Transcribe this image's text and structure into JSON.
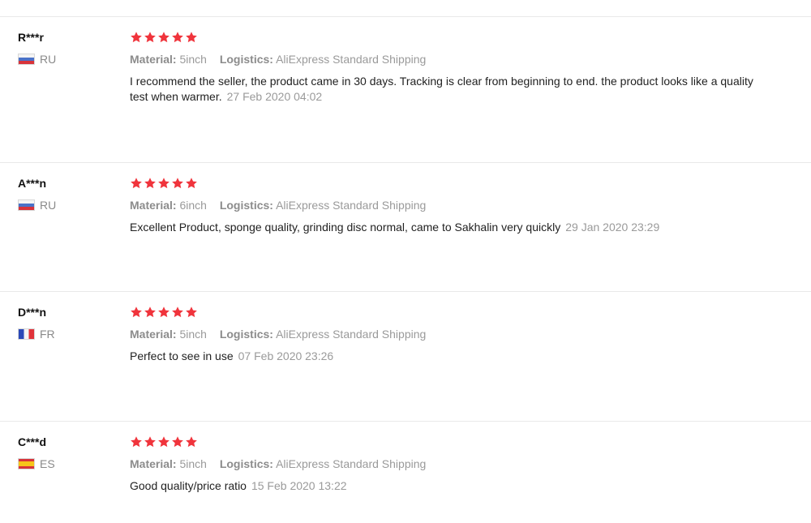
{
  "reviews": [
    {
      "user": "R***r",
      "country": "RU",
      "flag": "flag-ru",
      "rating": 5,
      "material_label": "Material:",
      "material_value": "5inch",
      "logistics_label": "Logistics:",
      "logistics_value": "AliExpress Standard Shipping",
      "text": "I recommend the seller, the product came in 30 days. Tracking is clear from beginning to end. the product looks like a quality test when warmer.",
      "date": "27 Feb 2020 04:02"
    },
    {
      "user": "A***n",
      "country": "RU",
      "flag": "flag-ru",
      "rating": 5,
      "material_label": "Material:",
      "material_value": "6inch",
      "logistics_label": "Logistics:",
      "logistics_value": "AliExpress Standard Shipping",
      "text": "Excellent Product, sponge quality, grinding disc normal, came to Sakhalin very quickly",
      "date": "29 Jan 2020 23:29"
    },
    {
      "user": "D***n",
      "country": "FR",
      "flag": "flag-fr",
      "rating": 5,
      "material_label": "Material:",
      "material_value": "5inch",
      "logistics_label": "Logistics:",
      "logistics_value": "AliExpress Standard Shipping",
      "text": "Perfect to see in use",
      "date": "07 Feb 2020 23:26"
    },
    {
      "user": "C***d",
      "country": "ES",
      "flag": "flag-es",
      "rating": 5,
      "material_label": "Material:",
      "material_value": "5inch",
      "logistics_label": "Logistics:",
      "logistics_value": "AliExpress Standard Shipping",
      "text": "Good quality/price ratio",
      "date": "15 Feb 2020 13:22"
    }
  ],
  "colors": {
    "star": "#f0343c",
    "muted": "#9a9a9a",
    "divider": "#e9e9e9"
  },
  "icons": {
    "star": "star-icon"
  }
}
